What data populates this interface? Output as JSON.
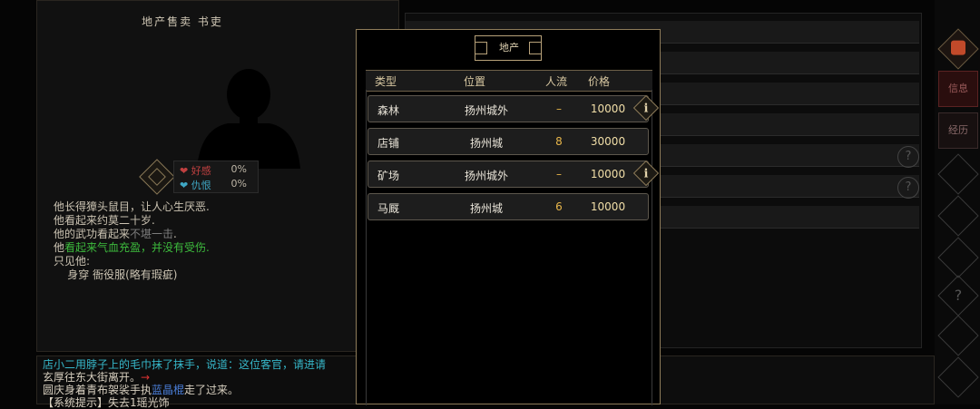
{
  "character": {
    "title": "地产售卖 书吏",
    "relations": [
      {
        "label": "好感",
        "value": "0%",
        "color": "#c04040"
      },
      {
        "label": "仇恨",
        "value": "0%",
        "color": "#3fa7c4"
      }
    ],
    "desc": [
      "他长得獐头鼠目，让人心生厌恶.",
      "他看起来约莫二十岁.",
      {
        "prefix": "他的武功看起来",
        "highlight": "不堪一击",
        "suffix": ".",
        "color": "gray"
      },
      {
        "prefix": "他",
        "highlight": "看起来气血充盈，并没有受伤",
        "suffix": ".",
        "color": "green"
      },
      "只见他:",
      "    身穿 衙役服(略有瑕疵)"
    ]
  },
  "modal": {
    "title": "地产",
    "columns": [
      "类型",
      "位置",
      "人流",
      "价格"
    ],
    "rows": [
      {
        "type": "森林",
        "location": "扬州城外",
        "flow": "–",
        "price": "10000",
        "info": true
      },
      {
        "type": "店铺",
        "location": "扬州城",
        "flow": "8",
        "price": "30000",
        "info": false
      },
      {
        "type": "矿场",
        "location": "扬州城外",
        "flow": "–",
        "price": "10000",
        "info": true
      },
      {
        "type": "马厩",
        "location": "扬州城",
        "flow": "6",
        "price": "10000",
        "info": false
      }
    ]
  },
  "side": {
    "tabs": [
      "信息",
      "经历"
    ],
    "help_symbol": "?"
  },
  "log": {
    "lines": [
      {
        "text": "店小二用脖子上的毛巾抹了抹手，说道：这位客官，请进请",
        "color": "cyan"
      },
      {
        "text": "玄厚往东大街离开。",
        "arrow": "→"
      },
      {
        "prefix": "圆庆身着青布袈裟手执",
        "name": "蓝晶棍",
        "suffix": "走了过来。"
      },
      {
        "text": "【系统提示】失去1瑶光饰"
      }
    ]
  },
  "colors": {
    "gold": "#b8a27a",
    "price": "#f2dfa8",
    "flow": "#e8b64a"
  }
}
